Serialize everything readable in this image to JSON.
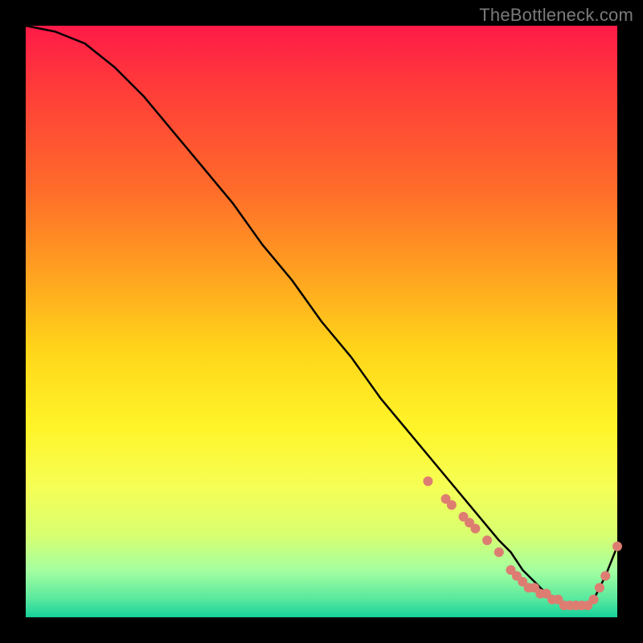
{
  "watermark": "TheBottleneck.com",
  "chart_data": {
    "type": "line",
    "title": "",
    "xlabel": "",
    "ylabel": "",
    "xlim": [
      0,
      100
    ],
    "ylim": [
      0,
      100
    ],
    "curve": {
      "x": [
        0,
        5,
        10,
        15,
        20,
        25,
        30,
        35,
        40,
        45,
        50,
        55,
        60,
        65,
        70,
        75,
        80,
        82,
        84,
        86,
        88,
        90,
        92,
        94,
        96,
        98,
        100
      ],
      "y": [
        100,
        99,
        97,
        93,
        88,
        82,
        76,
        70,
        63,
        57,
        50,
        44,
        37,
        31,
        25,
        19,
        13,
        11,
        8,
        6,
        4,
        3,
        2,
        2,
        3,
        7,
        12
      ]
    },
    "markers": {
      "x": [
        68,
        71,
        72,
        74,
        75,
        76,
        78,
        80,
        82,
        83,
        84,
        85,
        86,
        87,
        88,
        89,
        90,
        91,
        92,
        93,
        94,
        95,
        96,
        97,
        98,
        100
      ],
      "y": [
        23,
        20,
        19,
        17,
        16,
        15,
        13,
        11,
        8,
        7,
        6,
        5,
        5,
        4,
        4,
        3,
        3,
        2,
        2,
        2,
        2,
        2,
        3,
        5,
        7,
        12
      ],
      "color": "#dd7d72",
      "radius": 6
    }
  }
}
